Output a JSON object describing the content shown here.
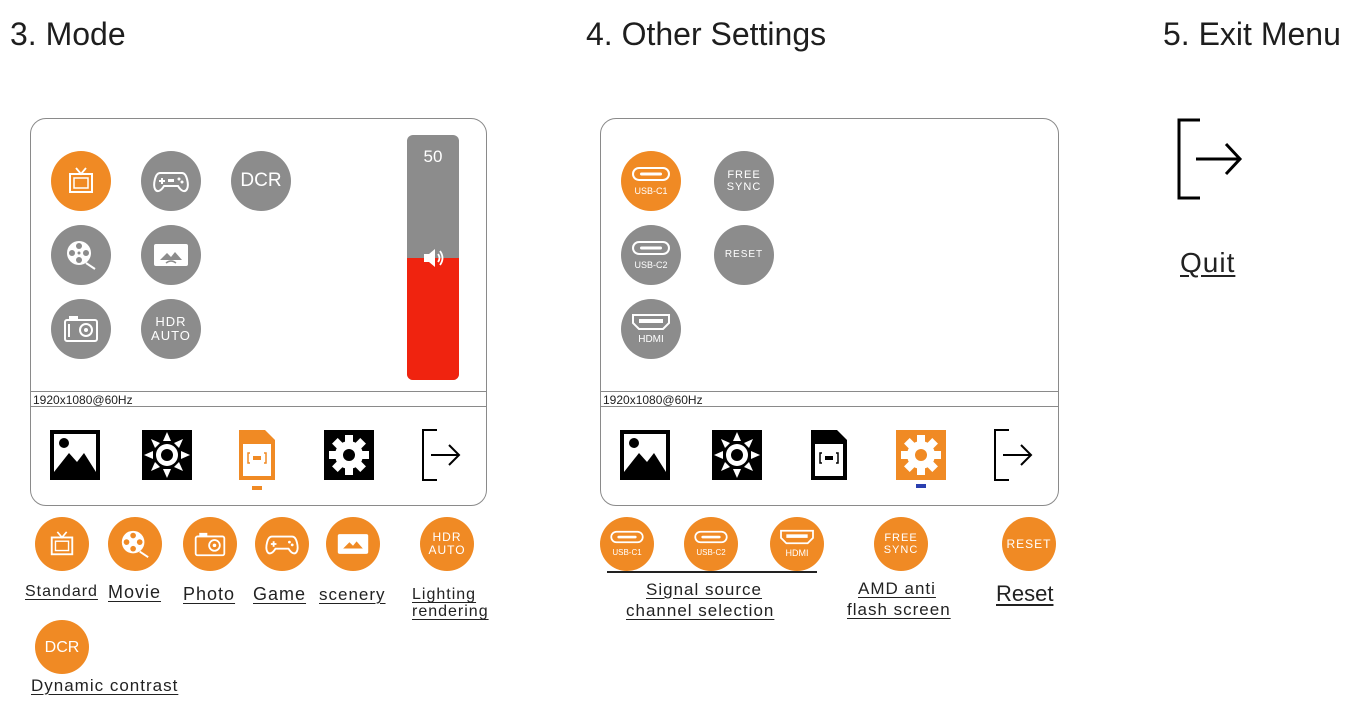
{
  "headings": {
    "mode": "3. Mode",
    "other": "4. Other Settings",
    "exit": "5. Exit Menu"
  },
  "mode_panel": {
    "resolution": "1920x1080@60Hz",
    "dcr_label": "DCR",
    "hdr_line1": "HDR",
    "hdr_line2": "AUTO",
    "volume_value": "50",
    "volume_fraction": 0.5,
    "selected_tab": "document",
    "tabs": [
      "image-icon",
      "brightness-icon",
      "document-icon",
      "gear-icon",
      "exit-icon"
    ]
  },
  "mode_legend": {
    "standard": "Standard",
    "movie": "Movie",
    "photo": "Photo",
    "game": "Game",
    "scenery": "scenery",
    "hdr_line1": "HDR",
    "hdr_line2": "AUTO",
    "lighting_line1": "Lighting",
    "lighting_line2": "rendering",
    "dcr": "DCR",
    "dynamic_contrast": "Dynamic contrast"
  },
  "other_panel": {
    "resolution": "1920x1080@60Hz",
    "usb_c1": "USB-C1",
    "usb_c2": "USB-C2",
    "hdmi": "HDMI",
    "free_line1": "FREE",
    "free_line2": "SYNC",
    "reset": "RESET",
    "selected_tab": "gear"
  },
  "other_legend": {
    "usb_c1": "USB-C1",
    "usb_c2": "USB-C2",
    "hdmi": "HDMI",
    "signal_line1": "Signal source",
    "signal_line2": "channel selection",
    "free_line1": "FREE",
    "free_line2": "SYNC",
    "amd_line1": "AMD anti",
    "amd_line2": "flash screen",
    "reset": "RESET",
    "reset_label": "Reset"
  },
  "exit": {
    "quit": "Quit"
  },
  "colors": {
    "accent": "#f08a24",
    "inactive": "#8c8c8c",
    "volume": "#f0230f",
    "indicator_blue": "#2a3fb0"
  }
}
